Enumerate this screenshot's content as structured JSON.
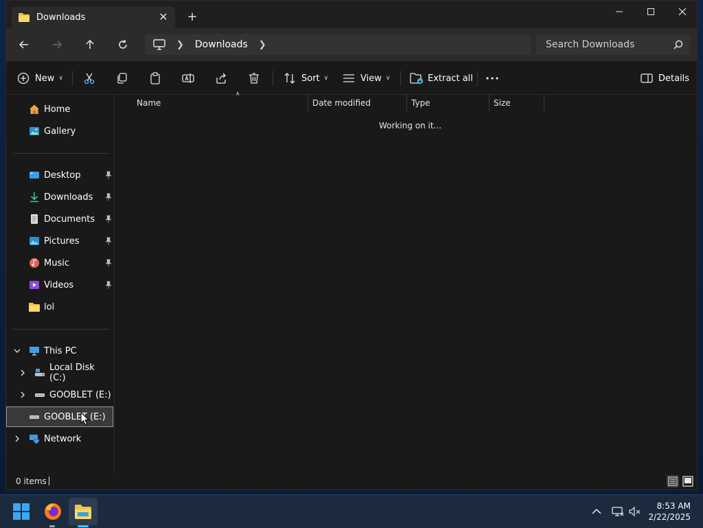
{
  "window": {
    "tab_title": "Downloads",
    "tab_close": "✕",
    "new_tab": "+"
  },
  "address": {
    "crumb": "Downloads",
    "search_placeholder": "Search Downloads"
  },
  "toolbar": {
    "new_label": "New",
    "sort_label": "Sort",
    "view_label": "View",
    "extract_label": "Extract all",
    "details_label": "Details"
  },
  "sidebar": {
    "quick": [
      {
        "label": "Home",
        "icon": "home-icon"
      },
      {
        "label": "Gallery",
        "icon": "gallery-icon"
      }
    ],
    "pinned": [
      {
        "label": "Desktop",
        "icon": "desktop-icon"
      },
      {
        "label": "Downloads",
        "icon": "download-icon"
      },
      {
        "label": "Documents",
        "icon": "documents-icon"
      },
      {
        "label": "Pictures",
        "icon": "pictures-icon"
      },
      {
        "label": "Music",
        "icon": "music-icon"
      },
      {
        "label": "Videos",
        "icon": "videos-icon"
      },
      {
        "label": "lol",
        "icon": "folder-icon"
      }
    ],
    "devices": [
      {
        "label": "This PC",
        "icon": "this-pc-icon"
      },
      {
        "label": "Local Disk (C:)",
        "icon": "disk-icon"
      },
      {
        "label": "GOOBLET (E:)",
        "icon": "drive-icon"
      },
      {
        "label": "GOOBLET (E:)",
        "icon": "drive-icon"
      },
      {
        "label": "Network",
        "icon": "network-icon"
      }
    ]
  },
  "content": {
    "columns": [
      "Name",
      "Date modified",
      "Type",
      "Size"
    ],
    "status_message": "Working on it..."
  },
  "statusbar": {
    "items_count": "0 items"
  },
  "taskbar": {
    "time": "8:53 AM",
    "date": "2/22/2025"
  },
  "colors": {
    "window_bg": "#191919",
    "titlebar": "#1f1f1f",
    "accent_blue": "#4cc2ff",
    "folder_yellow": "#f4c542"
  }
}
